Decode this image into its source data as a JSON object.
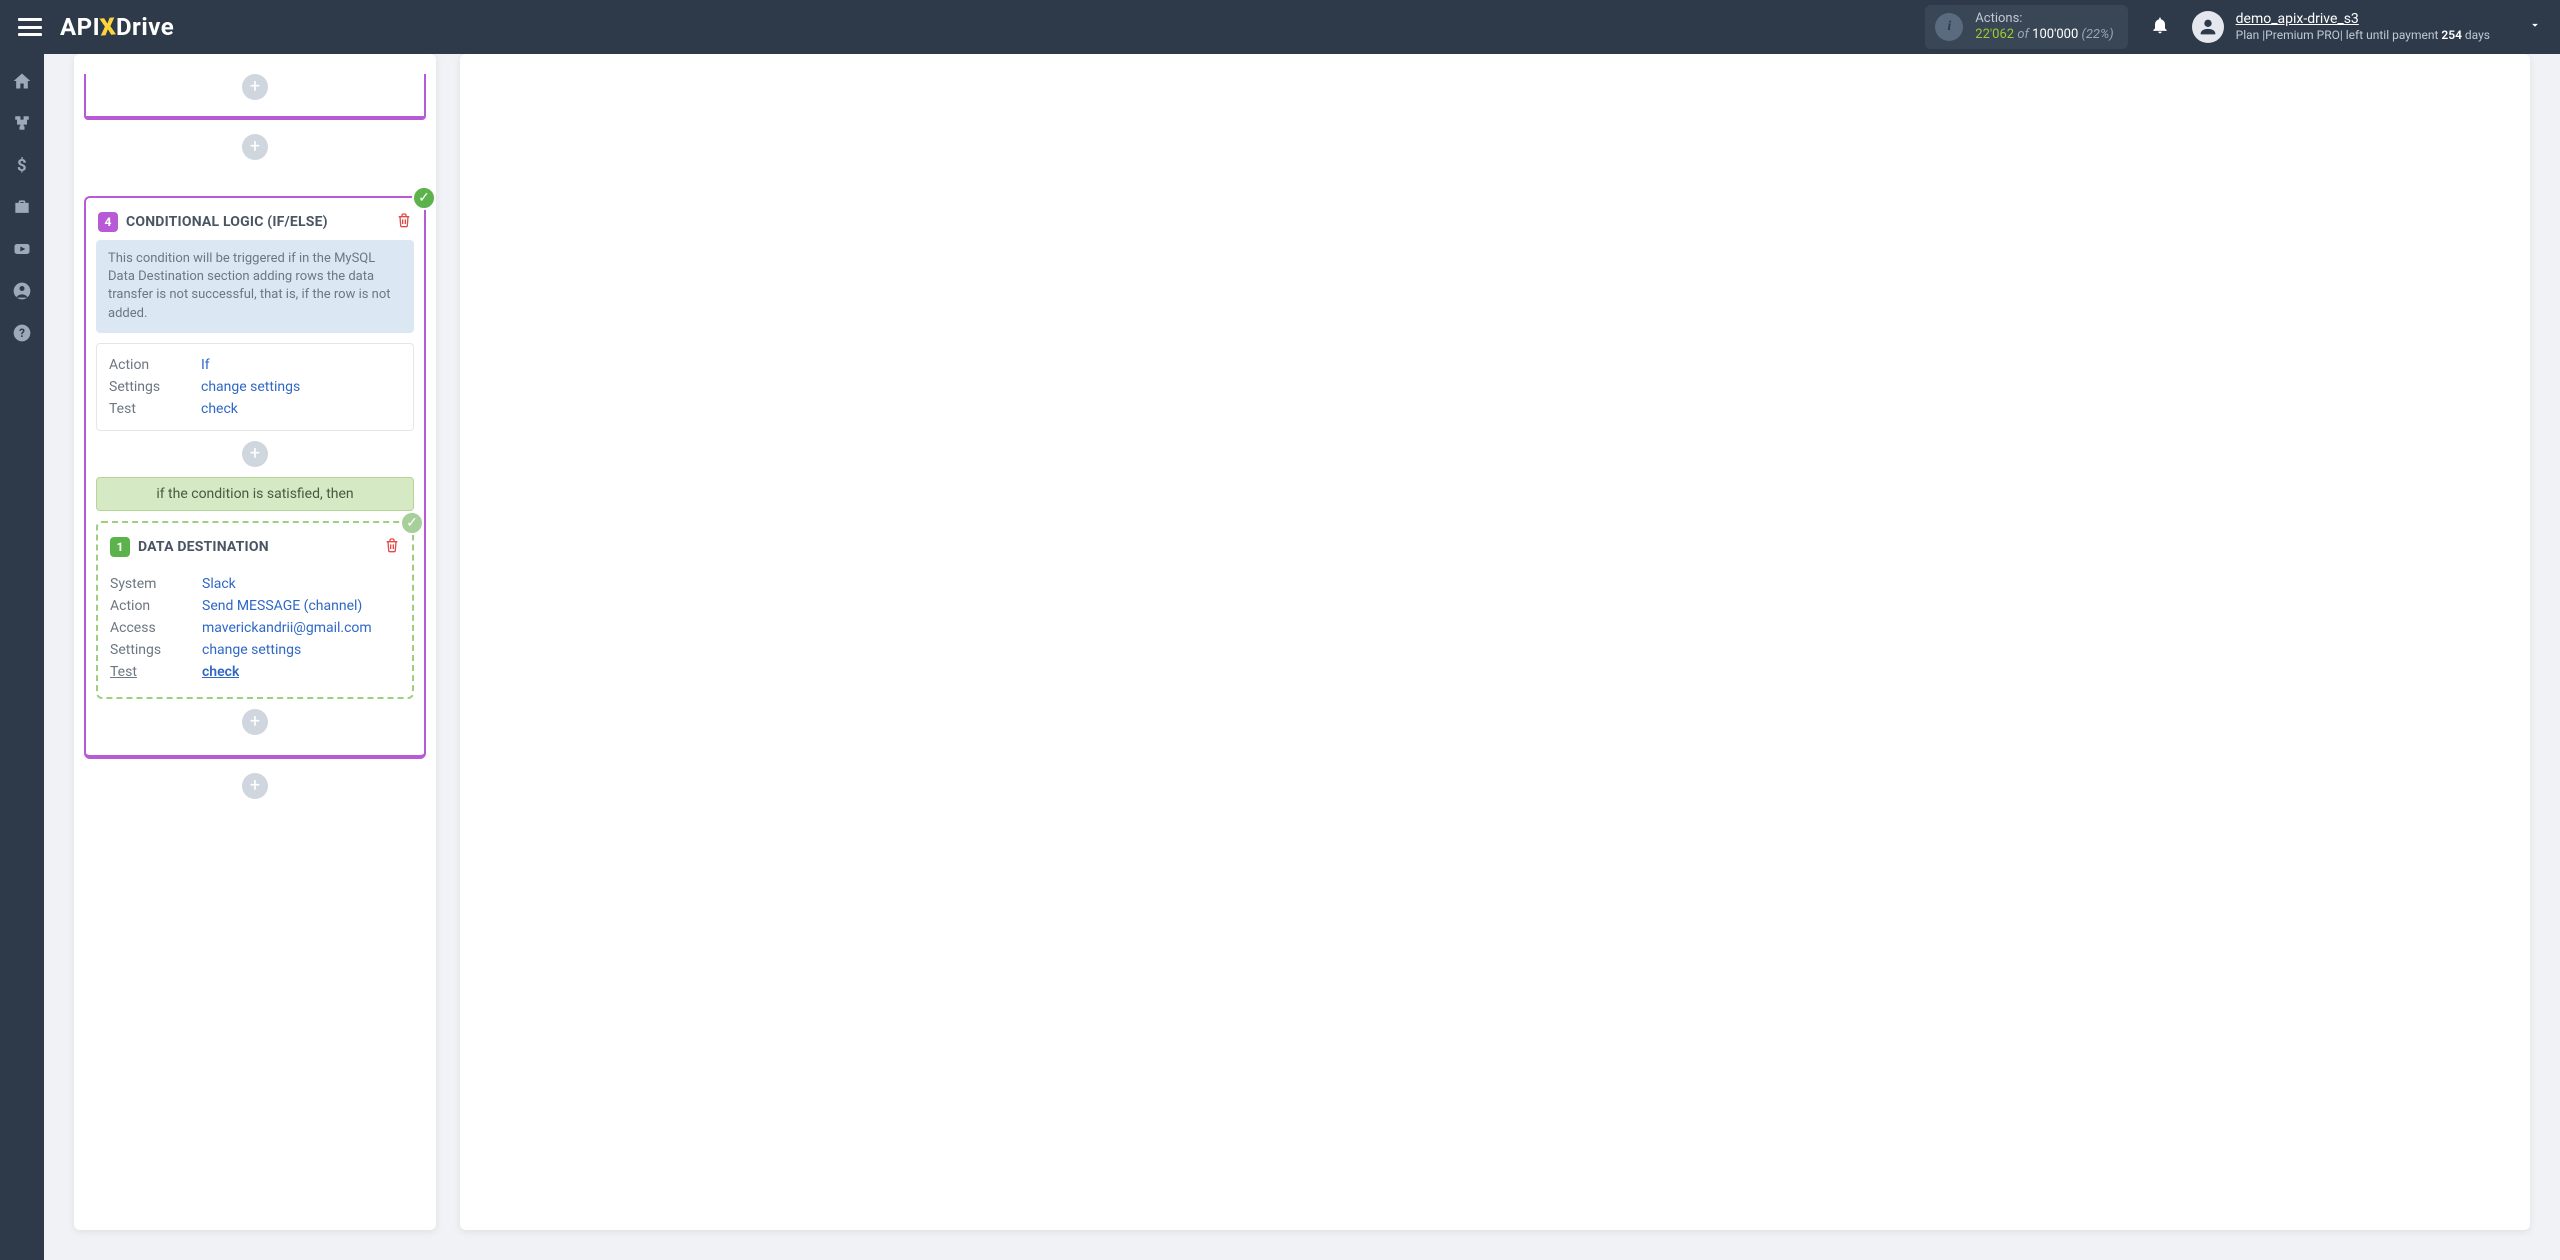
{
  "header": {
    "logo_left": "API",
    "logo_x": "X",
    "logo_right": "Drive",
    "actions_label": "Actions:",
    "actions_used": "22'062",
    "actions_of": "of",
    "actions_total": "100'000",
    "actions_pct": "(22%)",
    "username": "demo_apix-drive_s3",
    "plan_prefix": "Plan |Premium PRO| left until payment ",
    "plan_days": "254",
    "plan_suffix": " days"
  },
  "truncated_card": {
    "add": "+"
  },
  "between_add": "+",
  "logic_card": {
    "number": "4",
    "title": "CONDITIONAL LOGIC (IF/ELSE)",
    "status_check": "✓",
    "notice": "This condition will be triggered if in the MySQL Data Destination section adding rows the data transfer is not successful, that is, if the row is not added.",
    "rows": {
      "action_k": "Action",
      "action_v": "If",
      "settings_k": "Settings",
      "settings_v": "change settings",
      "test_k": "Test",
      "test_v": "check"
    },
    "inner_add": "+",
    "then_text": "if the condition is satisfied, then",
    "dest": {
      "number": "1",
      "title": "DATA DESTINATION",
      "status_check": "✓",
      "rows": {
        "system_k": "System",
        "system_v": "Slack",
        "action_k": "Action",
        "action_v": "Send MESSAGE (channel)",
        "access_k": "Access",
        "access_v": "maverickandrii@gmail.com",
        "settings_k": "Settings",
        "settings_v": "change settings",
        "test_k": "Test",
        "test_v": "check"
      }
    },
    "post_dest_add": "+"
  },
  "after_add": "+"
}
